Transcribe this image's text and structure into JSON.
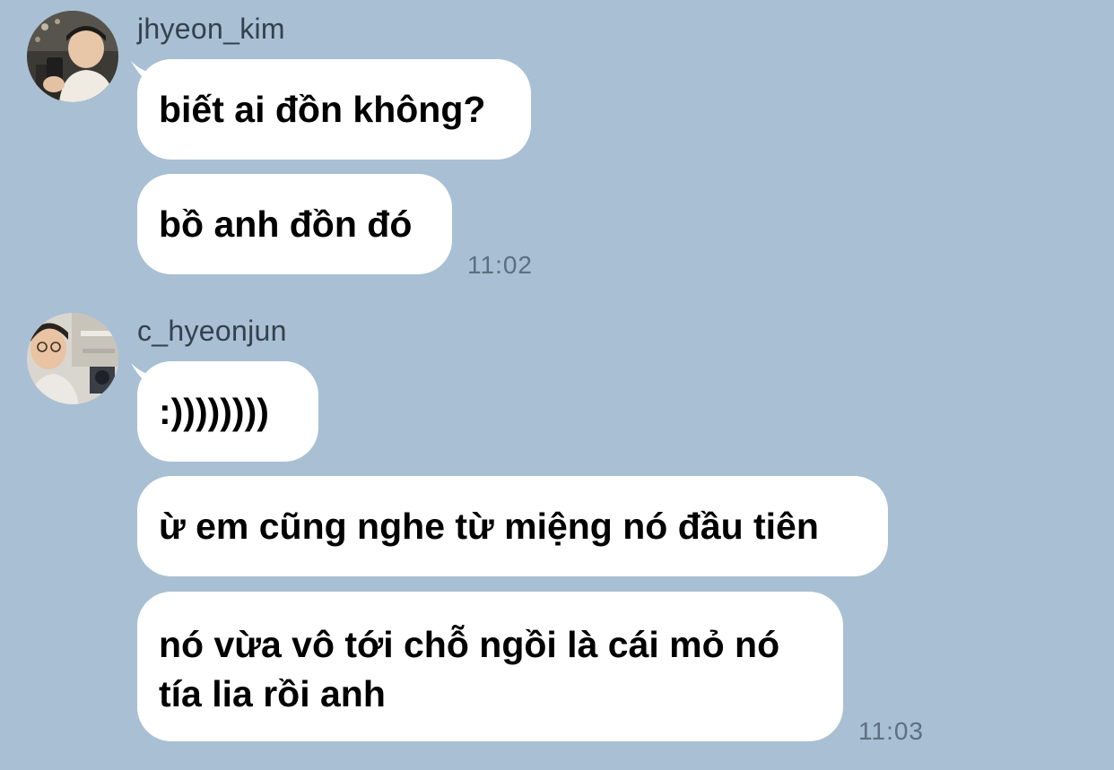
{
  "colors": {
    "background": "#a9bfd3",
    "bubble": "#ffffff",
    "username": "#33414f",
    "timestamp": "#5d6f80"
  },
  "groups": [
    {
      "username": "jhyeon_kim",
      "avatar_icon": "user-photo-avatar",
      "messages": [
        "biết ai đồn không?",
        "bồ anh đồn đó"
      ],
      "time": "11:02"
    },
    {
      "username": "c_hyeonjun",
      "avatar_icon": "user-photo-avatar",
      "messages": [
        ":))))))))",
        "ừ em cũng nghe từ miệng nó đầu tiên",
        "nó vừa vô tới chỗ ngồi là cái mỏ nó tía lia rồi anh"
      ],
      "time": "11:03"
    }
  ]
}
